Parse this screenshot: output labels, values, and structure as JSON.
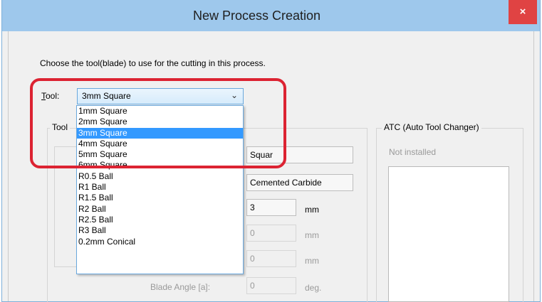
{
  "window": {
    "title": "New Process Creation",
    "close_label": "×"
  },
  "instruction": "Choose the tool(blade) to use for the cutting in this process.",
  "tool": {
    "label_accel": "T",
    "label_rest": "ool:",
    "selected": "3mm Square",
    "chevron": "⌄",
    "options": [
      "1mm Square",
      "2mm Square",
      "3mm Square",
      "4mm Square",
      "5mm Square",
      "6mm Square",
      "R0.5 Ball",
      "R1 Ball",
      "R1.5 Ball",
      "R2 Ball",
      "R2.5 Ball",
      "R3 Ball",
      "0.2mm Conical"
    ],
    "highlighted_index": 2
  },
  "tool_group": {
    "title": "Tool"
  },
  "properties": {
    "type_value": "Squar",
    "material_value": "Cemented Carbide",
    "diameter_value": "3",
    "diameter_unit": "mm",
    "field4_value": "0",
    "field4_unit": "mm",
    "field5_value": "0",
    "field5_unit": "mm",
    "blade_angle_label": "Blade Angle [a]:",
    "blade_angle_value": "0",
    "blade_angle_unit": "deg."
  },
  "atc": {
    "title": "ATC (Auto Tool Changer)",
    "status": "Not installed"
  }
}
